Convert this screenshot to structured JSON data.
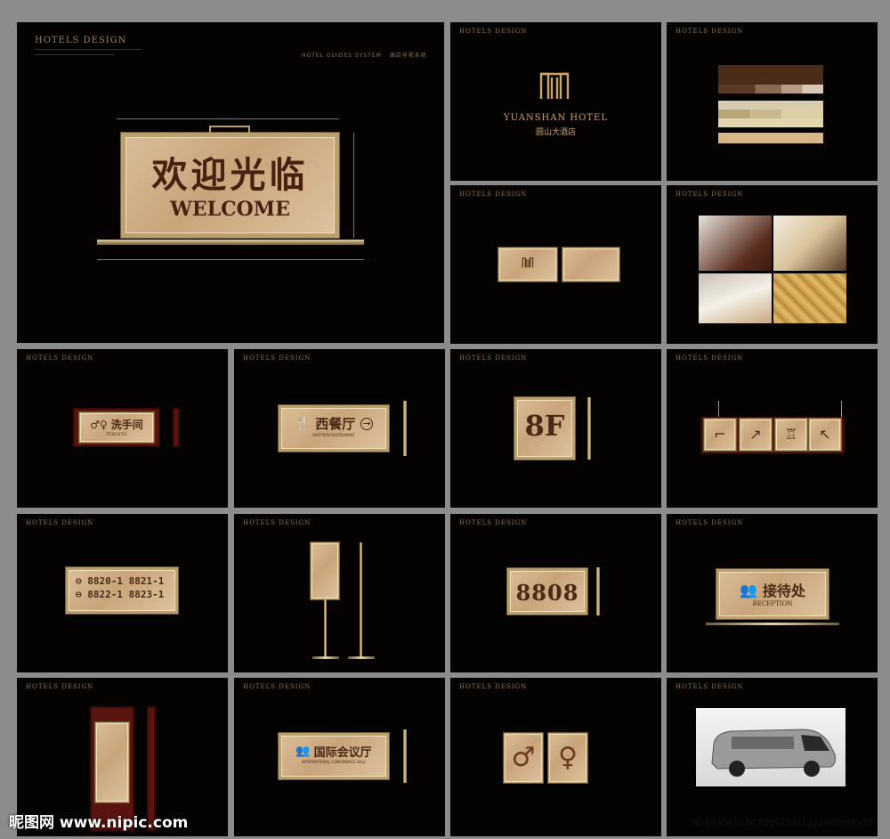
{
  "main_panel": {
    "brand": "HOTELS DESIGN",
    "subtitle": "HOTEL GUIDES SYSTEM",
    "subtitle_cn": "酒店导视系统",
    "sign_cn": "欢迎光临",
    "sign_en": "WELCOME"
  },
  "logo_panel": {
    "name_en": "YUANSHAN HOTEL",
    "name_cn": "圆山大酒店"
  },
  "toilet_sign": {
    "cn": "洗手间",
    "en": "TOILETS"
  },
  "restaurant_sign": {
    "cn": "西餐厅",
    "en": "WESTERN RESTAURANT"
  },
  "floor_sign": {
    "text": "8F"
  },
  "rooms_sign": {
    "r1": "8820-1 8821-1",
    "r2": "8822-1 8823-1"
  },
  "room_number": {
    "text": "8808"
  },
  "reception_sign": {
    "cn": "接待处",
    "en": "RECEPTION"
  },
  "conference_sign": {
    "cn": "国际会议厅",
    "en": "INTERNATIONAL CONFERENCE HALL"
  },
  "footer": {
    "watermark": "昵图网 www.nipic.com",
    "id_text": "ID:1535431 NO:20121021222442266337"
  },
  "colors": {
    "gold": "#b8a070",
    "panel_bg": "#050302",
    "sign_face": "#d2b48c",
    "red_board": "#5a1410"
  }
}
